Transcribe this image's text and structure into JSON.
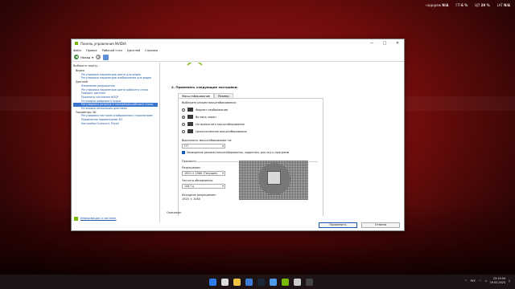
{
  "overlay": {
    "items": [
      {
        "label": "надоряж",
        "value": "N/A"
      },
      {
        "label": "ГП",
        "value": "6 %"
      },
      {
        "label": "ЦП",
        "value": "29 %"
      },
      {
        "label": "LAT",
        "value": "N/A"
      }
    ]
  },
  "window": {
    "title": "Панель управления NVIDIA",
    "controls": [
      "—",
      "□",
      "✕"
    ],
    "menu": [
      "Файл",
      "Правка",
      "Рабочий стол",
      "Дисплей",
      "Справка"
    ],
    "toolbar": {
      "back": "Назад"
    }
  },
  "tree": {
    "header": "Выберите задачу...",
    "items": [
      {
        "label": "Видео",
        "type": "cat"
      },
      {
        "label": "Регулировка параметров цвета для видео",
        "type": "item"
      },
      {
        "label": "Регулировка параметров изображения для видео",
        "type": "item"
      },
      {
        "label": "Дисплей",
        "type": "cat"
      },
      {
        "label": "Изменение разрешения",
        "type": "item"
      },
      {
        "label": "Регулировка параметров цвета рабочего стола",
        "type": "item"
      },
      {
        "label": "Поворот дисплея",
        "type": "item"
      },
      {
        "label": "Просмотр состояния HDCP",
        "type": "item"
      },
      {
        "label": "Установка цифрового аудио",
        "type": "item"
      },
      {
        "label": "Регулировка размера и положения рабочего стола",
        "type": "sel"
      },
      {
        "label": "Установка нескольких дисплеев",
        "type": "item"
      },
      {
        "label": "Параметры 3D",
        "type": "cat"
      },
      {
        "label": "Регулировка настроек изображения с просмотром",
        "type": "item"
      },
      {
        "label": "Управление параметрами 3D",
        "type": "item"
      },
      {
        "label": "Настройка Surround, PhysX",
        "type": "item"
      }
    ],
    "system_info": "Информация о системе"
  },
  "content": {
    "section_heading": "2. Применить следующие настройки:",
    "tabs": [
      "Масштабирование",
      "Размер"
    ],
    "mode_label": "Выберите режим масштабирования:",
    "modes": [
      {
        "label": "Формат изображения",
        "selected": false
      },
      {
        "label": "Во весь экран",
        "selected": true
      },
      {
        "label": "Не выполнять масштабирование",
        "selected": false
      },
      {
        "label": "Целочисленное масштабирование",
        "selected": false
      }
    ],
    "perform_label": "Выполнить масштабирование на:",
    "perform_value": "ГП",
    "override_label": "Замещение режима масштабирования, заданного для игр и программ",
    "preview_label": "Просмотр",
    "resolution_label": "Разрешение:",
    "resolution_value": "1920 × 1080 (Текущее)",
    "refresh_label": "Частота обновления:",
    "refresh_value": "144 Гц",
    "source_label": "Исходное разрешение:",
    "source_value": "1920 × 1080",
    "description_label": "Описание:",
    "apply": "Применить",
    "cancel": "Отмена"
  },
  "taskbar": {
    "lang": "РУС",
    "time": "23:19:04",
    "date": "19.02.2025",
    "apps": [
      "start",
      "search",
      "file-explorer",
      "browser",
      "steam",
      "store",
      "nvidia",
      "epic",
      "obs"
    ],
    "app_colors": [
      "#2b7de9",
      "#dddddd",
      "#f0c244",
      "#3d7dd8",
      "#1b2838",
      "#4c9be8",
      "#76b900",
      "#cccccc",
      "#444444"
    ]
  }
}
